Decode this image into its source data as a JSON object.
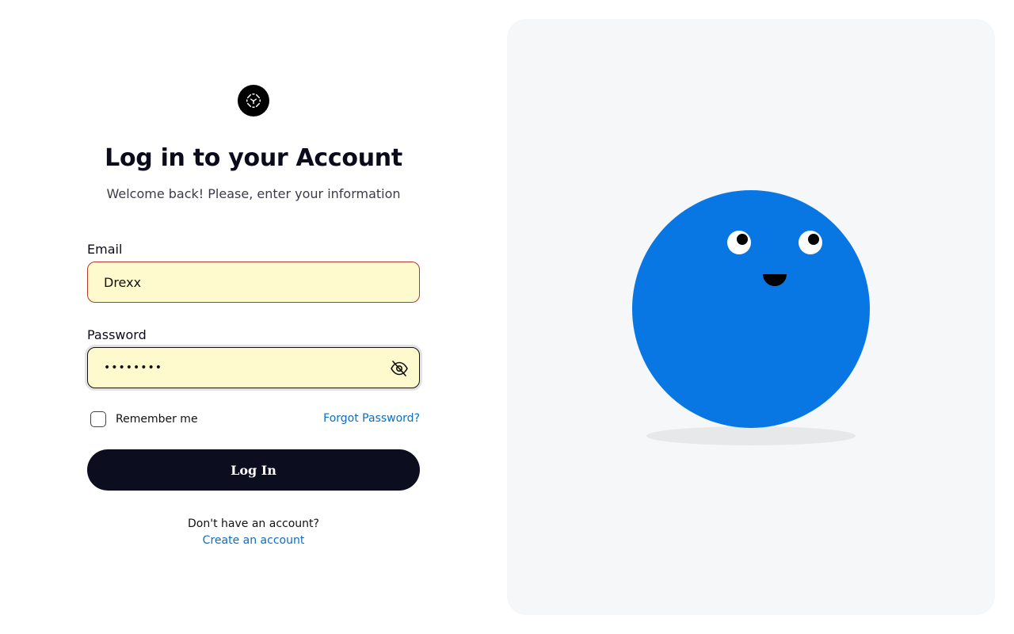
{
  "header": {
    "title": "Log in to your Account",
    "subtitle": "Welcome back! Please, enter your information"
  },
  "form": {
    "email_label": "Email",
    "email_value": "Drexx",
    "password_label": "Password",
    "password_value": "password",
    "remember_label": "Remember me",
    "remember_checked": false,
    "forgot_label": "Forgot Password?",
    "login_label": "Log In"
  },
  "footer": {
    "no_account_text": "Don't have an account?",
    "create_account_label": "Create an account"
  },
  "icons": {
    "logo": "scan-face-icon",
    "password_toggle": "eye-off-icon"
  },
  "colors": {
    "primary_button": "#0d0d20",
    "link": "#0a6fc2",
    "autofill_background": "#fffacd",
    "mascot": "#0877e4",
    "panel_background": "#f6f7f9"
  }
}
